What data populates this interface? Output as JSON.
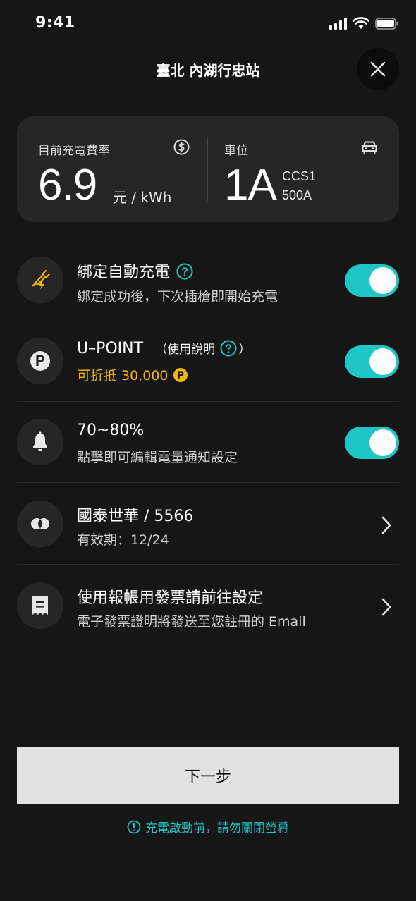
{
  "status_bar": {
    "time": "9:41"
  },
  "header": {
    "title": "臺北 內湖行忠站"
  },
  "card": {
    "rate_label": "目前充電費率",
    "rate_value": "6.9",
    "rate_unit": "元 / kWh",
    "spot_label": "車位",
    "spot_value": "1A",
    "connector_type": "CCS1",
    "connector_current": "500A"
  },
  "rows": [
    {
      "title": "綁定自動充電",
      "subtitle": "綁定成功後，下次插槍即開始充電",
      "toggle_on": true,
      "icon": "auto-charge-plug-icon"
    },
    {
      "title": "U–POINT",
      "title_note": "（使用說明",
      "title_note_close": "）",
      "subtitle": "可折抵 30,000",
      "toggle_on": true,
      "icon": "upoint-p-icon"
    },
    {
      "title": "70~80%",
      "subtitle": "點擊即可編輯電量通知設定",
      "toggle_on": true,
      "icon": "bell-icon"
    },
    {
      "title": "國泰世華 / 5566",
      "subtitle": "有效期：12/24",
      "icon": "credit-card-icon"
    },
    {
      "title": "使用報帳用發票請前往設定",
      "subtitle": "電子發票證明將發送至您註冊的 Email",
      "icon": "receipt-icon"
    }
  ],
  "footer": {
    "next_label": "下一步",
    "warning": "充電啟動前，請勿關閉螢幕"
  },
  "colors": {
    "accent": "#1ec6c6",
    "gold": "#f2b705",
    "background": "#161616",
    "card": "#262626"
  }
}
